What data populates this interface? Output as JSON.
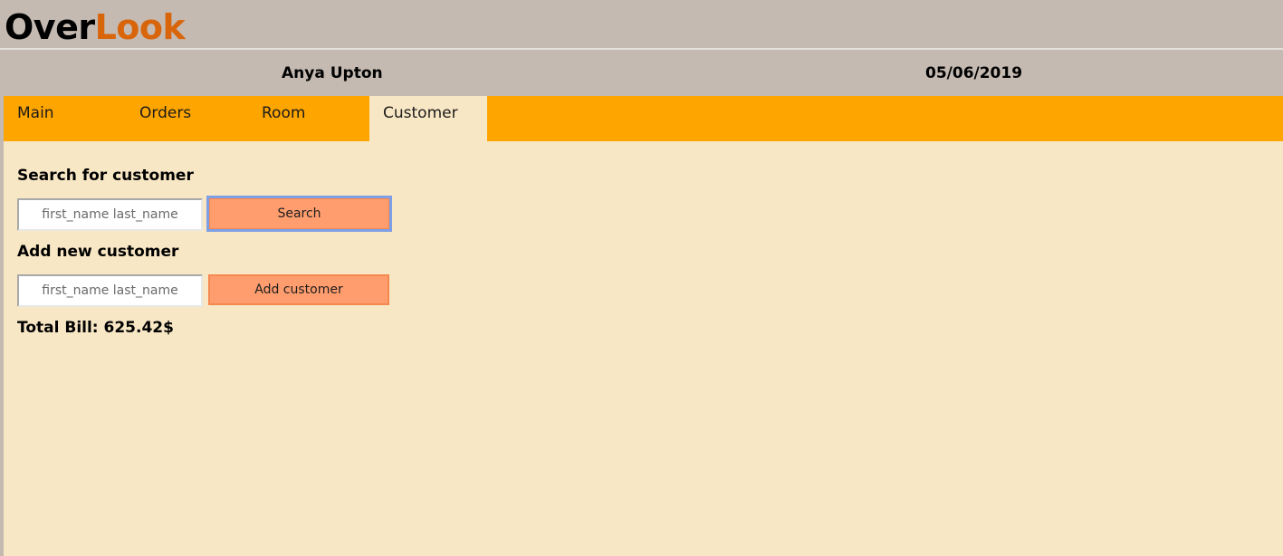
{
  "app": {
    "logo_part1": "Over",
    "logo_part2": "Look"
  },
  "info": {
    "user_name": "Anya Upton",
    "date": "05/06/2019"
  },
  "tabs": [
    {
      "label": "Main",
      "active": false
    },
    {
      "label": "Orders",
      "active": false
    },
    {
      "label": "Room",
      "active": false
    },
    {
      "label": "Customer",
      "active": true
    }
  ],
  "search": {
    "title": "Search for customer",
    "placeholder": "first_name last_name",
    "value": "",
    "button_label": "Search"
  },
  "add": {
    "title": "Add new customer",
    "placeholder": "first_name last_name",
    "value": "",
    "button_label": "Add customer"
  },
  "total": {
    "text": "Total Bill: 625.42$"
  },
  "colors": {
    "header_bg": "#c4bab1",
    "tab_bar": "#ffa500",
    "content_bg": "#f8e7c5",
    "button_bg": "#ff9d6e",
    "logo_accent": "#d9650b"
  }
}
